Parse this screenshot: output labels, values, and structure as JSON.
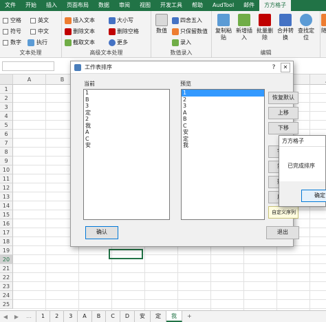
{
  "ribbon": {
    "tabs": [
      "文件",
      "开始",
      "插入",
      "页面布局",
      "数据",
      "审阅",
      "视图",
      "开发工具",
      "帮助",
      "AudTool",
      "邮件",
      "方方格子"
    ],
    "active_tab": "方方格子",
    "groups": {
      "text_process": {
        "label": "文本处理",
        "checks": [
          "空格",
          "英文",
          "符号",
          "中文",
          "数字",
          "执行"
        ]
      },
      "advanced_text": {
        "label": "高级文本处理",
        "buttons": [
          "插入文本",
          "大小写",
          "删除文本",
          "删除空格",
          "截取文本",
          "更多"
        ]
      },
      "numeric_entry": {
        "label": "数值录入",
        "big": "数值",
        "buttons": [
          "四舍五入",
          "只保留数值",
          "录入"
        ]
      },
      "edit": {
        "label": "编辑",
        "big_buttons": [
          "复制粘贴",
          "新增插入",
          "批量删除",
          "合并转换",
          "查找定位"
        ],
        "partial": "随"
      }
    }
  },
  "sheet": {
    "columns": [
      "A",
      "B",
      "C",
      "D",
      "E",
      "F",
      "G",
      "H",
      "I",
      "J"
    ],
    "rows": [
      "1",
      "2",
      "3",
      "4",
      "5",
      "6",
      "7",
      "8",
      "9",
      "10",
      "11",
      "12",
      "13",
      "14",
      "15",
      "16",
      "17",
      "18",
      "19",
      "20",
      "21",
      "22",
      "23",
      "24",
      "25"
    ],
    "selected_row": "20",
    "tabs": [
      "1",
      "2",
      "3",
      "A",
      "B",
      "C",
      "D",
      "安",
      "定",
      "我"
    ],
    "active_tab": "我",
    "add_sheet": "+"
  },
  "dialog": {
    "title": "工作表排序",
    "help": "?",
    "close": "✕",
    "current_label": "当前",
    "preview_label": "预览",
    "current_items": [
      "1",
      "B",
      "3",
      "定",
      "2",
      "我",
      "A",
      "C",
      "安"
    ],
    "preview_items": [
      "1",
      "2",
      "3",
      "A",
      "B",
      "C",
      "安",
      "定",
      "我"
    ],
    "buttons": {
      "restore": "恢复默认",
      "up": "上移",
      "down": "下移",
      "b4": "字",
      "b5": "笔",
      "b6": "数",
      "b7": "反",
      "b8": "自定义序列",
      "confirm": "确认",
      "exit": "退出"
    }
  },
  "message_box": {
    "title": "方方格子",
    "text": "已完成排序",
    "ok": "确定"
  }
}
